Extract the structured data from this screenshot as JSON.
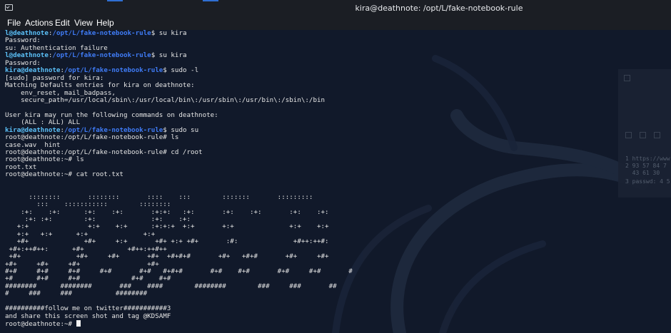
{
  "window": {
    "title": "kira@deathnote: /opt/L/fake-notebook-rule"
  },
  "menu": [
    "File",
    "Actions",
    "Edit",
    "View",
    "Help"
  ],
  "terminal": {
    "lines": [
      {
        "prompt_user": "l@deathnote",
        "prompt_path": "/opt/L/fake-notebook-rule",
        "prompt_end": "$",
        "cmd": " su kira"
      },
      {
        "text": "Password:"
      },
      {
        "text": "su: Authentication failure"
      },
      {
        "prompt_user": "l@deathnote",
        "prompt_path": "/opt/L/fake-notebook-rule",
        "prompt_end": "$",
        "cmd": " su kira"
      },
      {
        "text": "Password:"
      },
      {
        "prompt_user": "kira@deathnote",
        "prompt_path": "/opt/L/fake-notebook-rule",
        "prompt_end": "$",
        "cmd": " sudo -l"
      },
      {
        "text": "[sudo] password for kira:"
      },
      {
        "text": "Matching Defaults entries for kira on deathnote:"
      },
      {
        "text": "    env_reset, mail_badpass,"
      },
      {
        "text": "    secure_path=/usr/local/sbin\\:/usr/local/bin\\:/usr/sbin\\:/usr/bin\\:/sbin\\:/bin"
      },
      {
        "text": ""
      },
      {
        "text": "User kira may run the following commands on deathnote:"
      },
      {
        "text": "    (ALL : ALL) ALL"
      },
      {
        "prompt_user": "kira@deathnote",
        "prompt_path": "/opt/L/fake-notebook-rule",
        "prompt_end": "$",
        "cmd": " sudo su"
      },
      {
        "text": "root@deathnote:/opt/L/fake-notebook-rule# ls"
      },
      {
        "text": "case.wav  hint"
      },
      {
        "text": "root@deathnote:/opt/L/fake-notebook-rule# cd /root"
      },
      {
        "text": "root@deathnote:~# ls"
      },
      {
        "text": "root.txt"
      },
      {
        "text": "root@deathnote:~# cat root.txt"
      },
      {
        "text": ""
      },
      {
        "text": ""
      },
      {
        "text": "      ::::::::       ::::::::       ::::    :::        :::::::       :::::::::"
      },
      {
        "text": "        :::    :::::::::::        ::::::::"
      },
      {
        "text": "    :+:    :+:      :+:    :+:       :+:+:   :+:       :+:    :+:       :+:    :+:"
      },
      {
        "text": "     :+: :+:        :+:              :+:    :+:"
      },
      {
        "text": "   +:+               +:+    +:+      :+:+:+  +:+       +:+              +:+    +:+"
      },
      {
        "text": "   +:+   +:+      +:+              +:+"
      },
      {
        "text": "   +#+              +#+     +:+       +#+ +:+ +#+       :#:              +#++:++#:"
      },
      {
        "text": " +#+:++#++:      +#+           +#++:++#++"
      },
      {
        "text": " +#+              +#+     +#+       +#+  +#+#+#       +#+   +#+#       +#+     +#+"
      },
      {
        "text": "+#+     +#+     +#+                 +#+"
      },
      {
        "text": "#+#     #+#     #+#     #+#       #+#   #+#+#       #+#    #+#       #+#     #+#       #"
      },
      {
        "text": "+#      #+#     #+#             #+#    #+#"
      },
      {
        "text": "########      ########       ###    ####        ########        ###     ###       ##"
      },
      {
        "text": "#     ###     ###           ########"
      },
      {
        "text": ""
      },
      {
        "text": "##########follow me on twitter###########3"
      },
      {
        "text": "and share this screen shot and tag @KDSAMF"
      },
      {
        "text": "root@deathnote:~# ",
        "cursor": true
      }
    ]
  },
  "side_panel": {
    "rows": [
      "1 https://www.",
      "2 93 57 84 7",
      "  43 61 30",
      "3 passwd: 4 5"
    ]
  },
  "colors": {
    "prompt_user": "#5bc0f8",
    "prompt_path": "#3f7bf5",
    "text": "#e6e6e6",
    "background": "#11192a"
  },
  "icons": [
    "terminal-icon"
  ]
}
